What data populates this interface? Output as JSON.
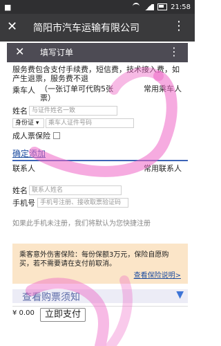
{
  "statusbar": {
    "time": "21:58",
    "left_glyph": "■",
    "icons": [
      "wifi-icon",
      "signal-icon",
      "battery-icon"
    ]
  },
  "appbar": {
    "title": "简阳市汽车运输有限公司",
    "close_glyph": "✕",
    "more_glyph": "⋮"
  },
  "inner_header": {
    "title": "填写订单",
    "close_glyph": "✕",
    "more_glyph": "⋮"
  },
  "notice_top": "服务费包含支付手续费，短信费，技术接入费，如产生退票，服务费不退",
  "passenger": {
    "section_label": "乘车人",
    "hint": "（一张订单可代购5张票）",
    "common_label": "常用乘车人",
    "name_label": "姓名",
    "name_placeholder": "与证件姓名一致",
    "id_type": "身份证",
    "id_placeholder": "乘车人证件号码",
    "adult_insurance_label": "成人票保险",
    "confirm_add": "确定添加"
  },
  "contact": {
    "section_label": "联系人",
    "common_label": "常用联系人",
    "name_label": "姓名",
    "name_placeholder": "联系人姓名",
    "phone_label": "手机号",
    "phone_placeholder": "手机号注册、接收取票验证码",
    "hint": "如果此手机未注册，我们将默认为您快捷注册"
  },
  "insurance": {
    "text": "乘客意外伤害保险：每份保额3万元，保险自愿购买，若不需要请在支付前取消。",
    "link": "查看保险说明>"
  },
  "buy_notice": {
    "label": "查看购票须知",
    "arrow": "▼"
  },
  "bottom": {
    "price": "¥ 0.00",
    "pay_label": "立即支付"
  },
  "colors": {
    "link": "#1f4ea1",
    "insurance_bg": "#fbe5c8",
    "swirl": "#ee66c6"
  }
}
